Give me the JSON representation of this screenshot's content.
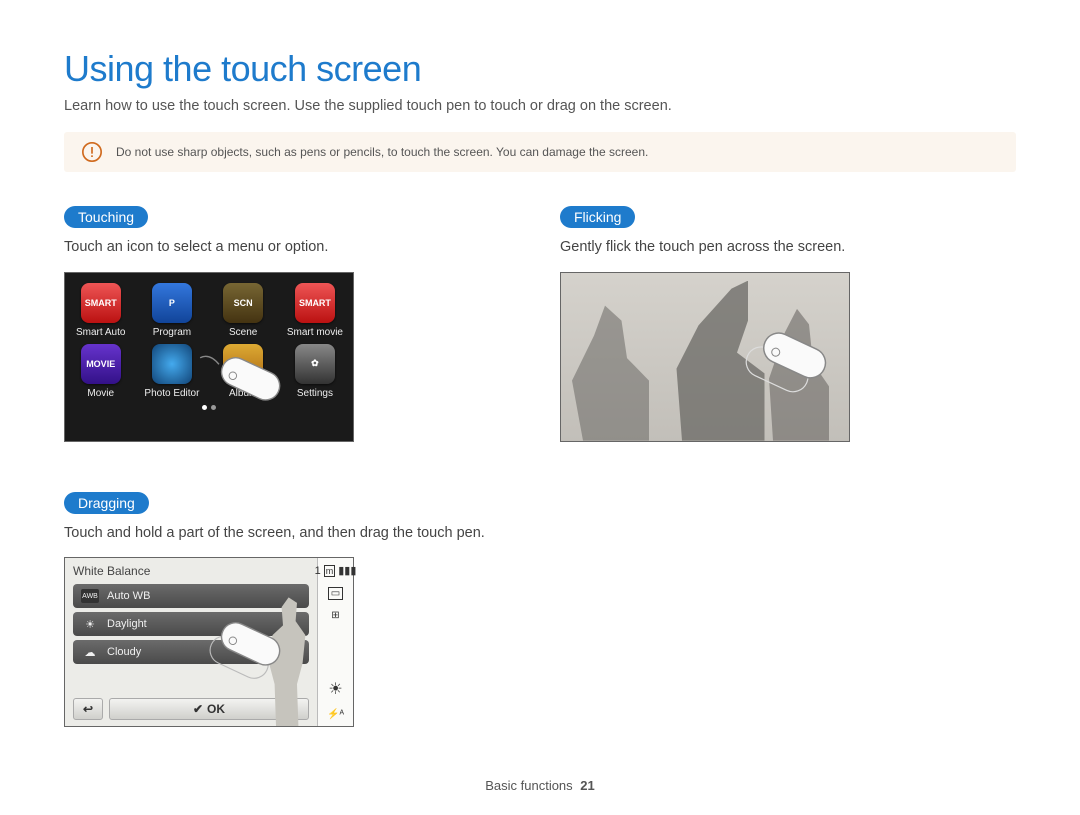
{
  "title": "Using the touch screen",
  "intro": "Learn how to use the touch screen. Use the supplied touch pen to touch or drag on the screen.",
  "warning": "Do not use sharp objects, such as pens or pencils, to touch the screen. You can damage the screen.",
  "sections": {
    "touching": {
      "label": "Touching",
      "desc": "Touch an icon to select a menu or option.",
      "icons": [
        {
          "label": "Smart Auto"
        },
        {
          "label": "Program"
        },
        {
          "label": "Scene"
        },
        {
          "label": "Smart movie"
        },
        {
          "label": "Movie"
        },
        {
          "label": "Photo Editor"
        },
        {
          "label": "Album"
        },
        {
          "label": "Settings"
        }
      ]
    },
    "flicking": {
      "label": "Flicking",
      "desc": "Gently flick the touch pen across the screen."
    },
    "dragging": {
      "label": "Dragging",
      "desc": "Touch and hold a part of the screen, and then drag the touch pen.",
      "wb_title": "White Balance",
      "wb_options": [
        {
          "label": "Auto WB"
        },
        {
          "label": "Daylight"
        },
        {
          "label": "Cloudy"
        }
      ],
      "ok": "OK",
      "status_count": "1"
    }
  },
  "footer": {
    "section": "Basic functions",
    "page": "21"
  }
}
